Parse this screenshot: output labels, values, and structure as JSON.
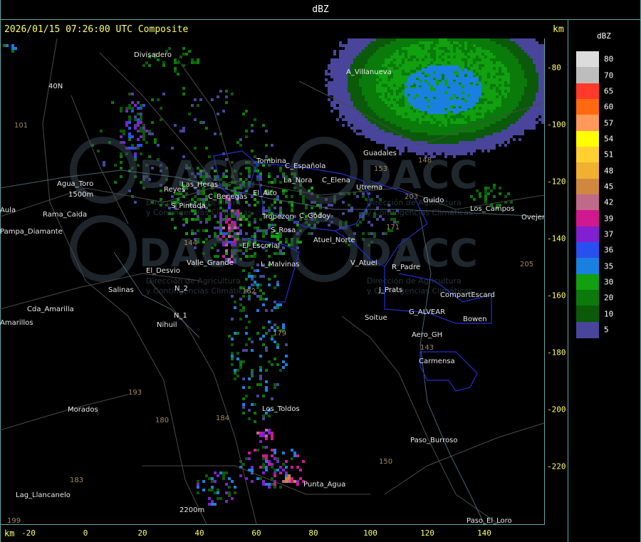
{
  "header": {
    "unit_title": "dBZ",
    "timestamp_title": "2026/01/15 07:26:00 UTC Composite",
    "top_unit": "km",
    "bottom_unit": "km"
  },
  "x_axis": {
    "ticks": [
      "-20",
      "0",
      "20",
      "40",
      "60",
      "80",
      "100",
      "120",
      "140"
    ]
  },
  "y_axis": {
    "ticks": [
      "-80",
      "-100",
      "-120",
      "-140",
      "-160",
      "-180",
      "-200",
      "-220"
    ]
  },
  "legend": {
    "title": "dBZ",
    "entries": [
      {
        "label": "80",
        "color": "#dcdcdc"
      },
      {
        "label": "70",
        "color": "#bdbdbd"
      },
      {
        "label": "65",
        "color": "#ff3a2a"
      },
      {
        "label": "60",
        "color": "#ff6a10"
      },
      {
        "label": "57",
        "color": "#ff9a5a"
      },
      {
        "label": "54",
        "color": "#ffff00"
      },
      {
        "label": "51",
        "color": "#ffd030"
      },
      {
        "label": "48",
        "color": "#f0b030"
      },
      {
        "label": "45",
        "color": "#d08840"
      },
      {
        "label": "42",
        "color": "#c06a8a"
      },
      {
        "label": "39",
        "color": "#d01890"
      },
      {
        "label": "37",
        "color": "#8020d0"
      },
      {
        "label": "36",
        "color": "#2850f0"
      },
      {
        "label": "35",
        "color": "#1a80e0"
      },
      {
        "label": "30",
        "color": "#10a010"
      },
      {
        "label": "20",
        "color": "#0a7a0a"
      },
      {
        "label": "10",
        "color": "#0a5a0a"
      },
      {
        "label": "5",
        "color": "#48459a"
      }
    ]
  },
  "places": [
    "Divisadero",
    "A_Villanueva",
    "40N",
    "101",
    "Guadales",
    "Tombina",
    "C_Española",
    "C_Elena",
    "Agua_Toro",
    "1500m",
    "La_Nora",
    "Los_Campos",
    "Guido",
    "Ovejeria",
    "Reyes",
    "Las_Heras",
    "S_Pintada",
    "C_Benegas",
    "El_Alto",
    "S_Rosa",
    "Pampa_Diamante",
    "Rama_Caida",
    "Utrema",
    "Tropezon",
    "C_Godoy",
    "Atuel_Norte",
    "El_Escorial",
    "Valle_Grande",
    "L_Malvinas",
    "V_Atuel",
    "R_Padre",
    "El_Desvio",
    "Salinas",
    "N_2",
    "J_Prats",
    "CompartEscard",
    "Cda_Amarilla",
    "N_1",
    "Nihuil",
    "G_ALVEAR",
    "Soitue",
    "Bowen",
    "Aero_GH",
    "Carmensa",
    "Morados",
    "Los_Toldos",
    "Paso_Burroso",
    "Punta_Agua",
    "Lag_Llancanelo",
    "2200m",
    "Paso_El_Loro",
    "Amarillos",
    "Aula",
    "179",
    "180",
    "184",
    "183",
    "150",
    "143",
    "171",
    "153",
    "148",
    "203",
    "205",
    "144",
    "162",
    "193",
    "199"
  ],
  "watermark": {
    "brand": "DACC",
    "line1": "Dirección de Agricultura",
    "line2": "y Contingencias Climáticas"
  }
}
